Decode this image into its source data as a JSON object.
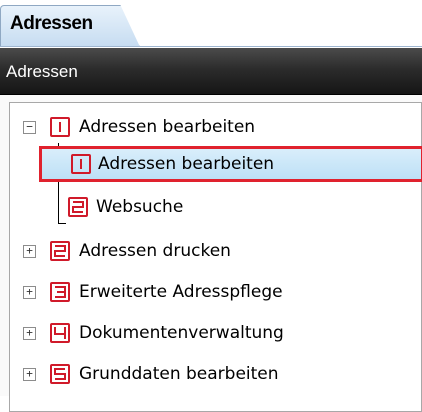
{
  "tab": {
    "label": "Adressen"
  },
  "panel": {
    "title": "Adressen"
  },
  "tree": {
    "items": [
      {
        "label": "Adressen bearbeiten",
        "number": "1",
        "expander": "−"
      },
      {
        "label": "Adressen bearbeiten",
        "number": "1",
        "selected": true
      },
      {
        "label": "Websuche",
        "number": "2"
      },
      {
        "label": "Adressen drucken",
        "number": "2",
        "expander": "+"
      },
      {
        "label": "Erweiterte Adresspflege",
        "number": "3",
        "expander": "+"
      },
      {
        "label": "Dokumentenverwaltung",
        "number": "4",
        "expander": "+"
      },
      {
        "label": "Grunddaten bearbeiten",
        "number": "5",
        "expander": "+"
      }
    ]
  },
  "colors": {
    "icon_red": "#d01a2a",
    "selection_border": "#e0222e",
    "selection_fill": "#c9e6f8"
  }
}
